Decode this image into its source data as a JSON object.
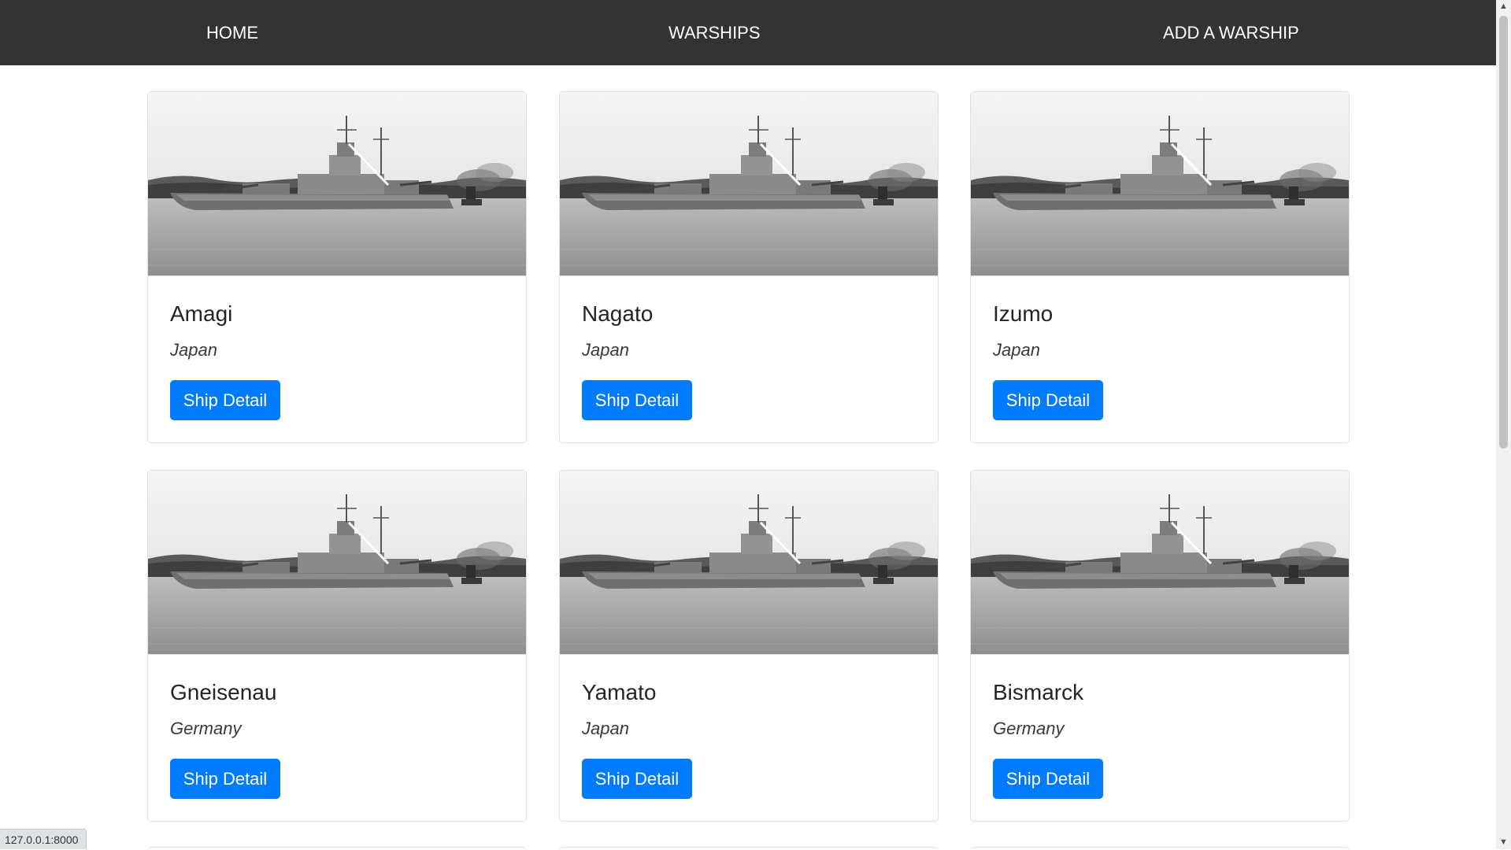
{
  "nav": {
    "items": [
      {
        "label": "HOME"
      },
      {
        "label": "WARSHIPS"
      },
      {
        "label": "ADD A WARSHIP"
      }
    ]
  },
  "ships": [
    {
      "name": "Amagi",
      "country": "Japan",
      "button_label": "Ship Detail",
      "image": "battleship-photo"
    },
    {
      "name": "Nagato",
      "country": "Japan",
      "button_label": "Ship Detail",
      "image": "battleship-photo"
    },
    {
      "name": "Izumo",
      "country": "Japan",
      "button_label": "Ship Detail",
      "image": "battleship-photo"
    },
    {
      "name": "Gneisenau",
      "country": "Germany",
      "button_label": "Ship Detail",
      "image": "battleship-photo"
    },
    {
      "name": "Yamato",
      "country": "Japan",
      "button_label": "Ship Detail",
      "image": "battleship-photo"
    },
    {
      "name": "Bismarck",
      "country": "Germany",
      "button_label": "Ship Detail",
      "image": "battleship-photo"
    }
  ],
  "status_bar": {
    "url": "127.0.0.1:8000"
  },
  "colors": {
    "navbar": "#333333",
    "button": "#007bff",
    "button_text": "#ffffff"
  }
}
